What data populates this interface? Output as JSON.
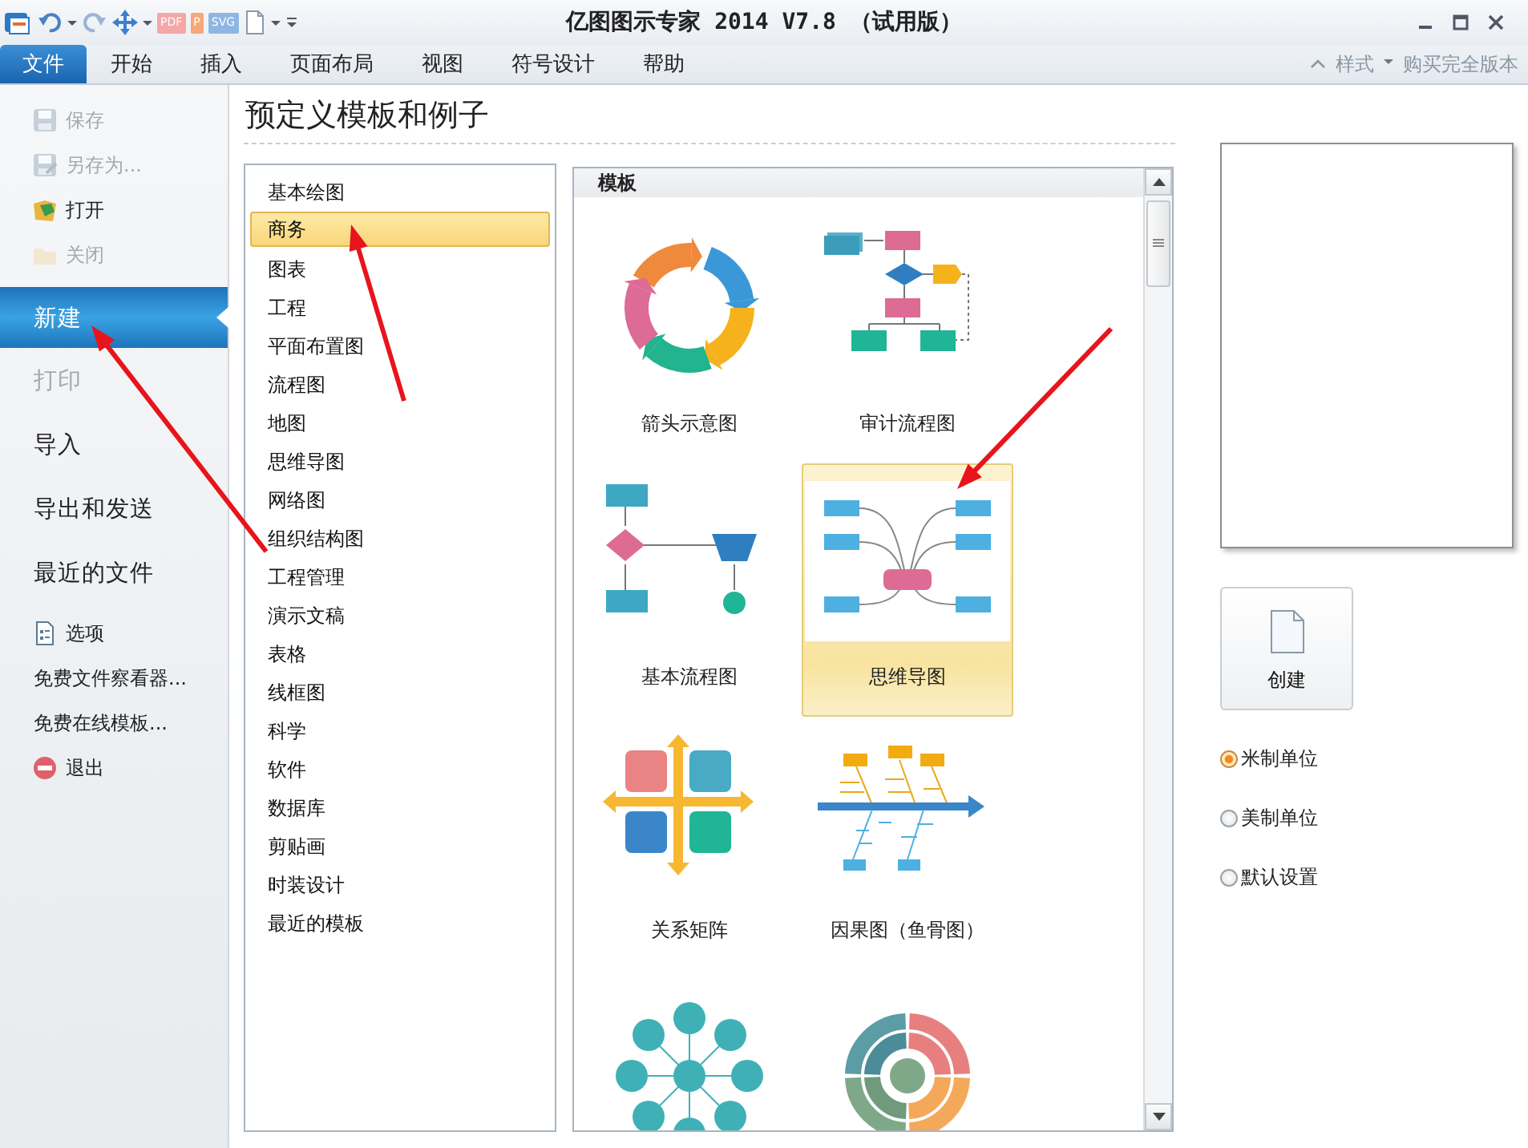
{
  "window": {
    "title": "亿图图示专家 2014 V7.8 （试用版）"
  },
  "quick_access": [
    {
      "kind": "app"
    },
    {
      "kind": "undo"
    },
    {
      "kind": "caret"
    },
    {
      "kind": "redo"
    },
    {
      "kind": "move"
    },
    {
      "kind": "caret"
    },
    {
      "kind": "badge",
      "label": "PDF",
      "color": "#f4a7a7"
    },
    {
      "kind": "badge",
      "label": "P",
      "color": "#f7a77a"
    },
    {
      "kind": "badge",
      "label": "SVG",
      "color": "#8fb6e2"
    },
    {
      "kind": "page"
    },
    {
      "kind": "caret"
    },
    {
      "kind": "customize"
    }
  ],
  "ribbon": {
    "tabs": [
      {
        "label": "文件",
        "selected": true
      },
      {
        "label": "开始",
        "selected": false
      },
      {
        "label": "插入",
        "selected": false
      },
      {
        "label": "页面布局",
        "selected": false
      },
      {
        "label": "视图",
        "selected": false
      },
      {
        "label": "符号设计",
        "selected": false
      },
      {
        "label": "帮助",
        "selected": false
      }
    ],
    "style_button": "样式",
    "buy_button": "购买完全版本"
  },
  "sidebar": {
    "items": [
      {
        "kind": "save",
        "label": "保存",
        "disabled": true,
        "selected": false
      },
      {
        "kind": "saveas",
        "label": "另存为...",
        "disabled": true,
        "selected": false
      },
      {
        "kind": "open",
        "label": "打开",
        "disabled": false,
        "selected": false
      },
      {
        "kind": "close",
        "label": "关闭",
        "disabled": true,
        "selected": false
      },
      {
        "kind": "section",
        "label": "新建",
        "disabled": false,
        "selected": true
      },
      {
        "kind": "section",
        "label": "打印",
        "disabled": true,
        "selected": false
      },
      {
        "kind": "section",
        "label": "导入",
        "disabled": false,
        "selected": false
      },
      {
        "kind": "section",
        "label": "导出和发送",
        "disabled": false,
        "selected": false
      },
      {
        "kind": "section",
        "label": "最近的文件",
        "disabled": false,
        "selected": false
      },
      {
        "kind": "options",
        "label": "选项",
        "disabled": false,
        "selected": false
      },
      {
        "kind": "link",
        "label": "免费文件察看器...",
        "disabled": false,
        "selected": false
      },
      {
        "kind": "link",
        "label": "免费在线模板...",
        "disabled": false,
        "selected": false
      },
      {
        "kind": "exit",
        "label": "退出",
        "disabled": false,
        "selected": false
      }
    ]
  },
  "heading": "预定义模板和例子",
  "categories": [
    {
      "label": "基本绘图",
      "selected": false
    },
    {
      "label": "商务",
      "selected": true
    },
    {
      "label": "图表",
      "selected": false
    },
    {
      "label": "工程",
      "selected": false
    },
    {
      "label": "平面布置图",
      "selected": false
    },
    {
      "label": "流程图",
      "selected": false
    },
    {
      "label": "地图",
      "selected": false
    },
    {
      "label": "思维导图",
      "selected": false
    },
    {
      "label": "网络图",
      "selected": false
    },
    {
      "label": "组织结构图",
      "selected": false
    },
    {
      "label": "工程管理",
      "selected": false
    },
    {
      "label": "演示文稿",
      "selected": false
    },
    {
      "label": "表格",
      "selected": false
    },
    {
      "label": "线框图",
      "selected": false
    },
    {
      "label": "科学",
      "selected": false
    },
    {
      "label": "软件",
      "selected": false
    },
    {
      "label": "数据库",
      "selected": false
    },
    {
      "label": "剪贴画",
      "selected": false
    },
    {
      "label": "时装设计",
      "selected": false
    },
    {
      "label": "最近的模板",
      "selected": false
    }
  ],
  "templates": {
    "header": "模板",
    "items": [
      {
        "kind": "cycle",
        "label": "箭头示意图",
        "selected": false
      },
      {
        "kind": "audit",
        "label": "审计流程图",
        "selected": false
      },
      {
        "kind": "flow",
        "label": "基本流程图",
        "selected": false
      },
      {
        "kind": "mindmap",
        "label": "思维导图",
        "selected": true
      },
      {
        "kind": "matrix",
        "label": "关系矩阵",
        "selected": false
      },
      {
        "kind": "fishbone",
        "label": "因果图（鱼骨图）",
        "selected": false
      },
      {
        "kind": "network",
        "selected": false
      },
      {
        "kind": "rings",
        "selected": false
      }
    ]
  },
  "preview": {
    "create_button": "创建",
    "units": [
      {
        "label": "米制单位",
        "selected": true
      },
      {
        "label": "美制单位",
        "selected": false
      },
      {
        "label": "默认设置",
        "selected": false
      }
    ]
  }
}
